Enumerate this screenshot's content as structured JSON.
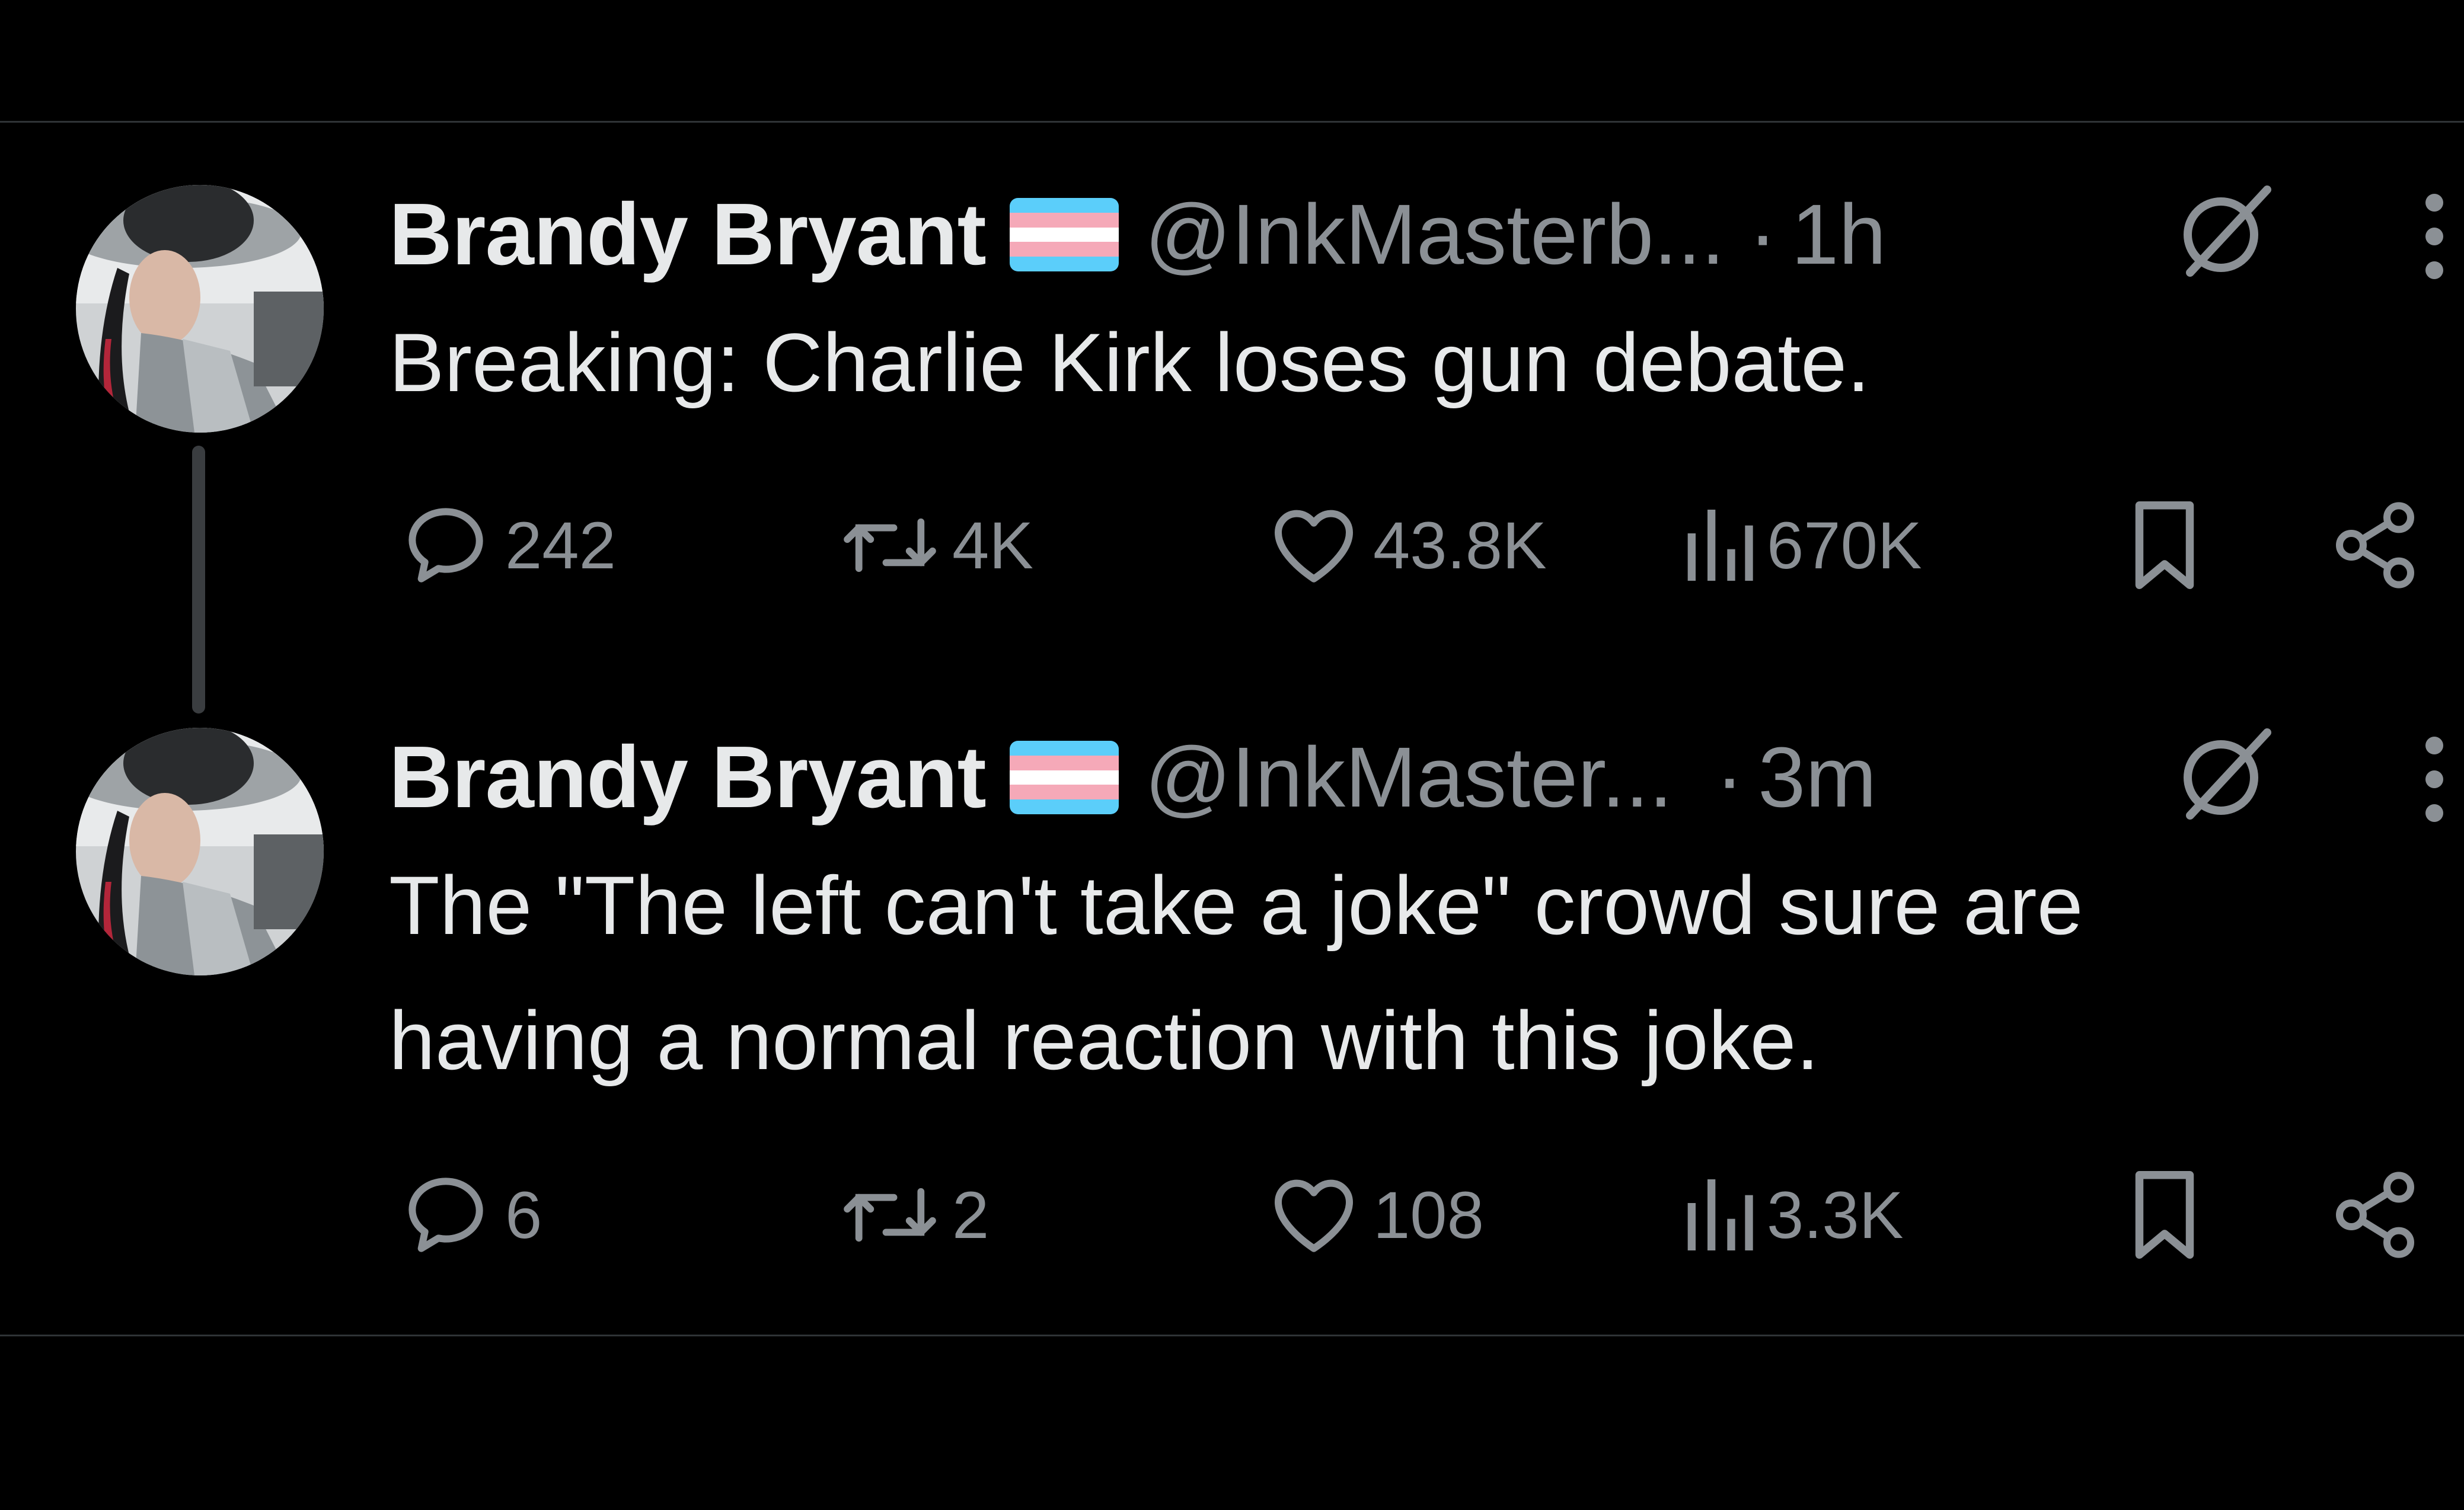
{
  "tweets": [
    {
      "name": "Brandy Bryant",
      "flag": "transgender-flag",
      "handle": "@InkMasterb...",
      "separator": "·",
      "time": "1h",
      "text_lines": [
        "Breaking: Charlie Kirk loses gun debate."
      ],
      "replies": "242",
      "reposts": "4K",
      "likes": "43.8K",
      "views": "670K"
    },
    {
      "name": "Brandy Bryant",
      "flag": "transgender-flag",
      "handle": "@InkMaster...",
      "separator": "·",
      "time": "3m",
      "text_lines": [
        "The \"The left can't take a joke\" crowd sure are",
        "having a normal reaction with this joke."
      ],
      "replies": "6",
      "reposts": "2",
      "likes": "108",
      "views": "3.3K"
    }
  ],
  "icons": {
    "reply": "reply-bubble-icon",
    "repost": "repost-arrows-icon",
    "like": "heart-icon",
    "views": "bar-chart-icon",
    "bookmark": "bookmark-icon",
    "share": "share-icon",
    "grok": "grok-slash-icon",
    "more": "more-vertical-icon"
  },
  "colors": {
    "background": "#000000",
    "primary_text": "#e7e9ea",
    "secondary_text": "#8b9095",
    "flag_blue": "#5bcefa",
    "flag_pink": "#f5a9b8",
    "flag_white": "#ffffff"
  }
}
